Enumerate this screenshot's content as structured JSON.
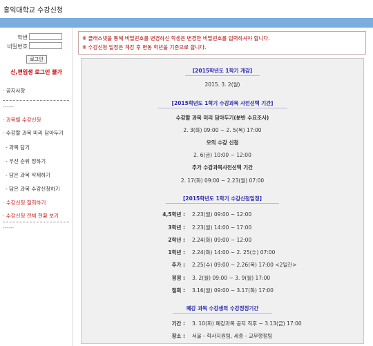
{
  "header": {
    "title": "홍익대학교 수강신청"
  },
  "login": {
    "id_label": "학번",
    "pw_label": "비밀번호",
    "id_value": "",
    "pw_value": "",
    "login_button": "로그인",
    "warning": "신,편입생 로그인 불가"
  },
  "menu": {
    "notice": "· 공지사항",
    "dashes": "--------------------",
    "dashes_short": "------",
    "section_title": "· 과목별 수강신청",
    "cart": "· 수강할 과목 미리 담아두기",
    "items": [
      {
        "label": "- 과목 담기"
      },
      {
        "label": "- 우선 순위 정하기"
      },
      {
        "label": "- 담은 과목 삭제하기"
      },
      {
        "label": "- 담은 과목 수강신청하기"
      }
    ],
    "cancel": "· 수강신청 철회하기",
    "status": "· 수강신청 전체 현황 보기"
  },
  "notices": [
    "※ 클래스넷을 통해 비밀번호를 변경하신 학생은 변경한 비밀번호를 입력하셔야 합니다.",
    "※ 수강신청 일정은 계강 후 변동 학년을 기준으로 합니다."
  ],
  "schedule": {
    "s1_title": "[2015학년도 1학기 개강]",
    "s1_date": "2015. 3. 2(월)",
    "s2_title": "[2015학년도 1학기 수강과목 사전선택 기간]",
    "s2_sub1": "수강할 과목 미리 담아두기(분반 수요조사)",
    "s2_sub1_date": "2. 3(화) 09:00 ~ 2. 5(목) 17:00",
    "s2_sub2": "모의 수강 신청",
    "s2_sub2_date": "2. 6(금) 10:00 ~ 12:00",
    "s2_sub3": "추가 수강과목사전선택 기간",
    "s2_sub3_date": "2. 17(화) 09:00 ~ 2.23(월) 07:00",
    "s3_title": "[2015학년도 1학기 수강신청일정]",
    "s3_rows": [
      {
        "k": "4,5학년 :",
        "v": "2.23(월) 09:00 ~ 12:00"
      },
      {
        "k": "3학년 :",
        "v": "2.23(월) 14:00 ~ 17:00"
      },
      {
        "k": "2학년 :",
        "v": "2.24(화) 09:00 ~ 12:00"
      },
      {
        "k": "1학년 :",
        "v": "2.24(화) 14:00 ~ 2. 25(수) 07:00"
      },
      {
        "k": "추가 :",
        "v": "2.25(수) 09:00 ~ 2.26(목) 17:00 <2일간>"
      },
      {
        "k": "정정 :",
        "v": "3. 2(월) 09:00 ~ 3. 9(월) 17:00"
      },
      {
        "k": "철회 :",
        "v": "3.16(월) 09:00 ~ 3.17(화) 17:00"
      }
    ],
    "s4_title": "폐강 과목 수강생의 수강정정기간",
    "s4_rows": [
      {
        "k": "기간 :",
        "v": "3. 10(화) 폐강과목 공지 직후 ~ 3.13(금) 17:00"
      },
      {
        "k": "장소 :",
        "v": "서울 - 학사지원팀, 세종 - 교무행정팀"
      }
    ]
  }
}
